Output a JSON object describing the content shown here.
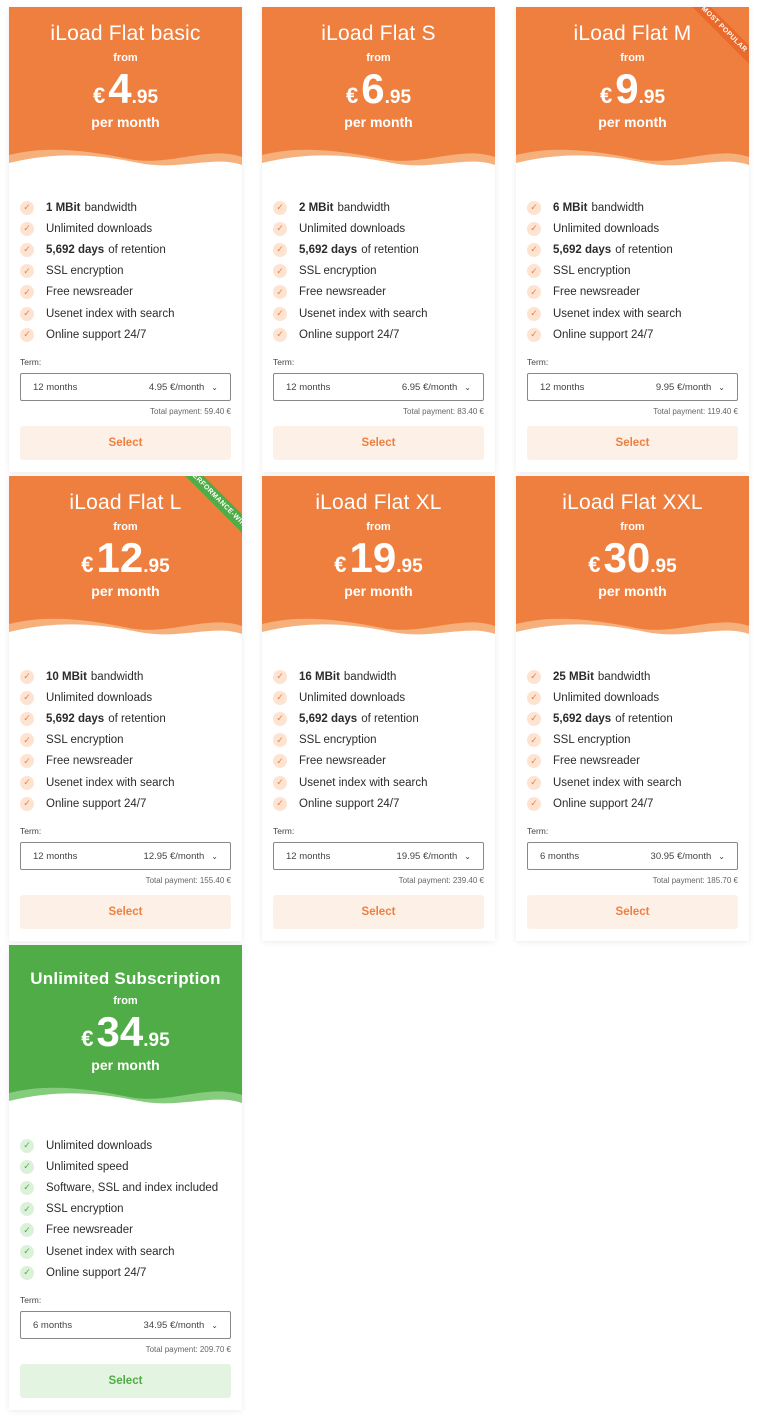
{
  "plans": [
    {
      "name": "iLoad Flat basic",
      "from": "from",
      "currency": "€",
      "price_int": "4",
      "price_dec": ".95",
      "per": "per month",
      "bandwidth_bold": "1 MBit",
      "features": [
        "Unlimited downloads",
        "SSL encryption",
        "Free newsreader",
        "Usenet index with search",
        "Online support 24/7"
      ],
      "term_label": "Term:",
      "term": "12 months",
      "term_price": "4.95 €/month",
      "total": "Total payment: 59.40 €",
      "select": "Select"
    },
    {
      "name": "iLoad Flat S",
      "from": "from",
      "currency": "€",
      "price_int": "6",
      "price_dec": ".95",
      "per": "per month",
      "bandwidth_bold": "2 MBit",
      "term_label": "Term:",
      "term": "12 months",
      "term_price": "6.95 €/month",
      "total": "Total payment: 83.40 €",
      "select": "Select"
    },
    {
      "name": "iLoad Flat M",
      "from": "from",
      "currency": "€",
      "price_int": "9",
      "price_dec": ".95",
      "per": "per month",
      "bandwidth_bold": "6 MBit",
      "ribbon": "MOST POPULAR",
      "term_label": "Term:",
      "term": "12 months",
      "term_price": "9.95 €/month",
      "total": "Total payment: 119.40 €",
      "select": "Select"
    },
    {
      "name": "iLoad Flat L",
      "from": "from",
      "currency": "€",
      "price_int": "12",
      "price_dec": ".95",
      "per": "per month",
      "bandwidth_bold": "10 MBit",
      "ribbon": "PERFORMANCE-WIN",
      "term_label": "Term:",
      "term": "12 months",
      "term_price": "12.95 €/month",
      "total": "Total payment: 155.40 €",
      "select": "Select"
    },
    {
      "name": "iLoad Flat XL",
      "from": "from",
      "currency": "€",
      "price_int": "19",
      "price_dec": ".95",
      "per": "per month",
      "bandwidth_bold": "16 MBit",
      "term_label": "Term:",
      "term": "12 months",
      "term_price": "19.95 €/month",
      "total": "Total payment: 239.40 €",
      "select": "Select"
    },
    {
      "name": "iLoad Flat XXL",
      "from": "from",
      "currency": "€",
      "price_int": "30",
      "price_dec": ".95",
      "per": "per month",
      "bandwidth_bold": "25 MBit",
      "term_label": "Term:",
      "term": "6 months",
      "term_price": "30.95 €/month",
      "total": "Total payment: 185.70 €",
      "select": "Select"
    }
  ],
  "common_features": {
    "bandwidth_suffix": "bandwidth",
    "unlimited_downloads": "Unlimited downloads",
    "retention_bold": "5,692 days",
    "retention_suffix": "of retention",
    "ssl": "SSL encryption",
    "newsreader": "Free newsreader",
    "usenet": "Usenet index with search",
    "support": "Online support 24/7"
  },
  "unlimited": {
    "name": "Unlimited Subscription",
    "from": "from",
    "currency": "€",
    "price_int": "34",
    "price_dec": ".95",
    "per": "per month",
    "features": [
      "Unlimited downloads",
      "Unlimited speed",
      "Software, SSL and index included",
      "SSL encryption",
      "Free newsreader",
      "Usenet index with search",
      "Online support 24/7"
    ],
    "term_label": "Term:",
    "term": "6 months",
    "term_price": "34.95 €/month",
    "total": "Total payment: 209.70 €",
    "select": "Select"
  },
  "colors": {
    "orange": "#ef7f3f",
    "orange_light": "#f6b07c",
    "green": "#4fac46",
    "green_light": "#86cc7d"
  },
  "icons": {
    "check": "check-icon",
    "chevron": "chevron-down-icon"
  }
}
